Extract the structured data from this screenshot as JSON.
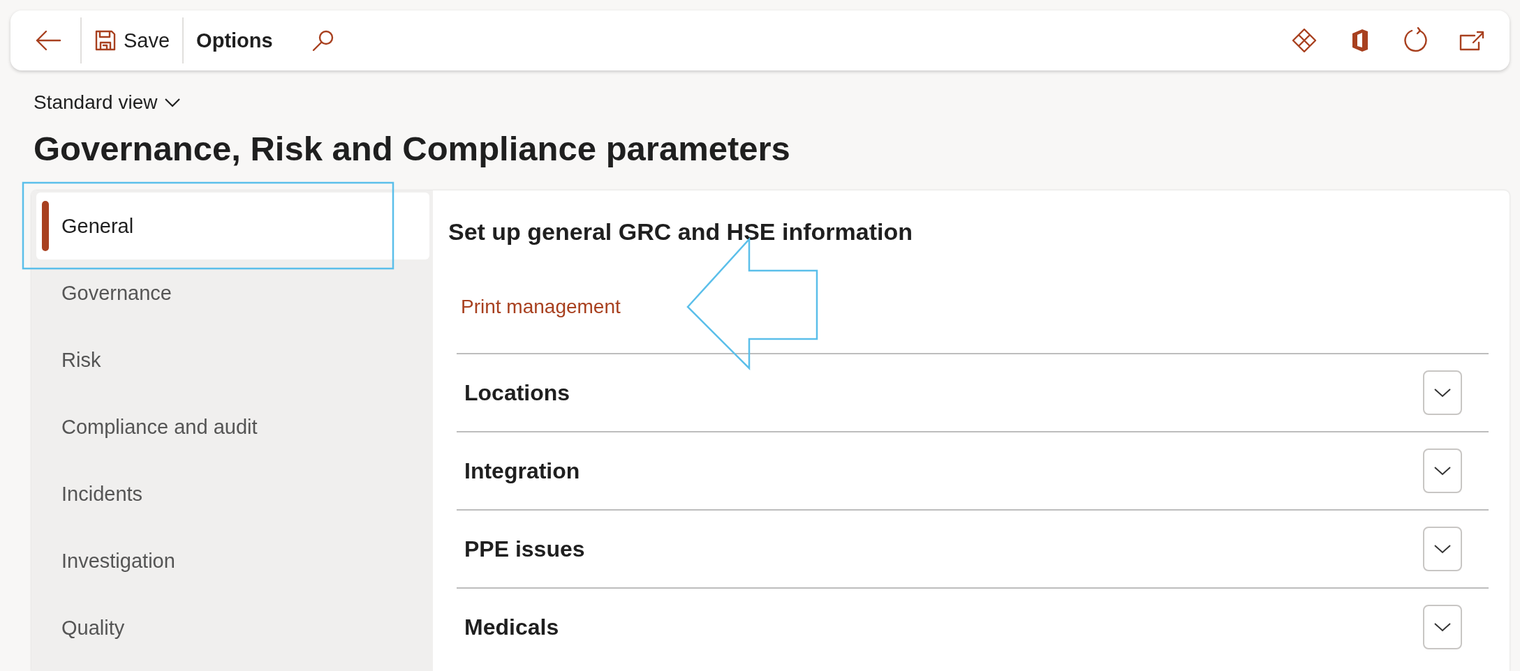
{
  "toolbar": {
    "buttons": [
      {
        "kind": "back"
      },
      {
        "kind": "save",
        "label": "Save"
      },
      {
        "kind": "options",
        "label": "Options"
      },
      {
        "kind": "search"
      }
    ],
    "right_icons": [
      {
        "kind": "diamond"
      },
      {
        "kind": "office"
      },
      {
        "kind": "refresh"
      },
      {
        "kind": "popout"
      }
    ]
  },
  "view_selector": {
    "label": "Standard view"
  },
  "page_title": "Governance, Risk and Compliance parameters",
  "sidebar": {
    "items": [
      {
        "label": "General",
        "selected": true
      },
      {
        "label": "Governance",
        "selected": false
      },
      {
        "label": "Risk",
        "selected": false
      },
      {
        "label": "Compliance and audit",
        "selected": false
      },
      {
        "label": "Incidents",
        "selected": false
      },
      {
        "label": "Investigation",
        "selected": false
      },
      {
        "label": "Quality",
        "selected": false
      }
    ]
  },
  "content": {
    "heading": "Set up general GRC and HSE information",
    "link": "Print management",
    "sections": [
      {
        "title": "Locations",
        "expanded": false
      },
      {
        "title": "Integration",
        "expanded": false
      },
      {
        "title": "PPE issues",
        "expanded": false
      },
      {
        "title": "Medicals",
        "expanded": false
      }
    ]
  },
  "annotations": [
    {
      "kind": "highlight-box"
    },
    {
      "kind": "arrow"
    }
  ]
}
